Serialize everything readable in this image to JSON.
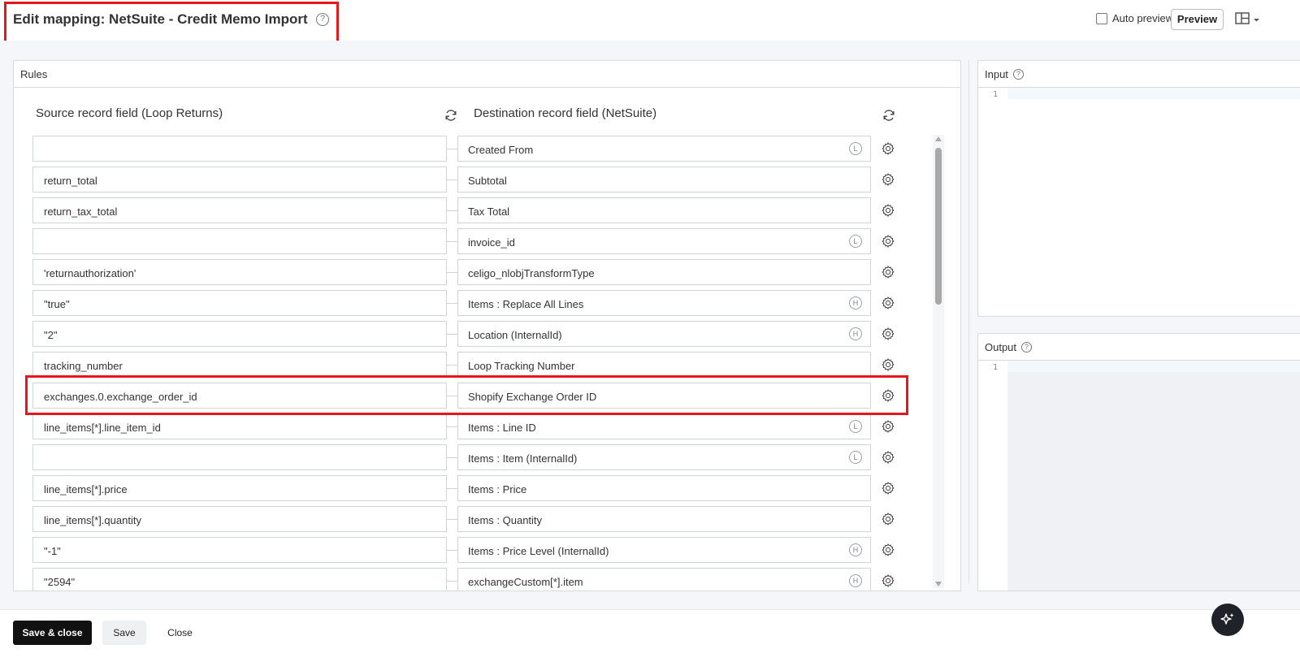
{
  "header": {
    "title": "Edit mapping: NetSuite - Credit Memo Import",
    "help_glyph": "?",
    "auto_preview_label": "Auto preview",
    "preview_button": "Preview"
  },
  "rules": {
    "panel_title": "Rules",
    "source_header": "Source record field (Loop Returns)",
    "destination_header": "Destination record field (NetSuite)",
    "rows": [
      {
        "source": "",
        "destination": "Created From",
        "badge": "L"
      },
      {
        "source": "return_total",
        "destination": "Subtotal",
        "badge": ""
      },
      {
        "source": "return_tax_total",
        "destination": "Tax Total",
        "badge": ""
      },
      {
        "source": "",
        "destination": "invoice_id",
        "badge": "L"
      },
      {
        "source": "'returnauthorization'",
        "destination": "celigo_nlobjTransformType",
        "badge": ""
      },
      {
        "source": "\"true\"",
        "destination": "Items : Replace All Lines",
        "badge": "H"
      },
      {
        "source": "\"2\"",
        "destination": "Location (InternalId)",
        "badge": "H"
      },
      {
        "source": "tracking_number",
        "destination": "Loop Tracking Number",
        "badge": ""
      },
      {
        "source": "exchanges.0.exchange_order_id",
        "destination": "Shopify Exchange Order ID",
        "badge": ""
      },
      {
        "source": "line_items[*].line_item_id",
        "destination": "Items : Line ID",
        "badge": "L"
      },
      {
        "source": "",
        "destination": "Items : Item (InternalId)",
        "badge": "L"
      },
      {
        "source": "line_items[*].price",
        "destination": "Items : Price",
        "badge": ""
      },
      {
        "source": "line_items[*].quantity",
        "destination": "Items : Quantity",
        "badge": ""
      },
      {
        "source": "\"-1\"",
        "destination": "Items : Price Level (InternalId)",
        "badge": "H"
      },
      {
        "source": "\"2594\"",
        "destination": "exchangeCustom[*].item",
        "badge": "H"
      }
    ]
  },
  "input_panel": {
    "title": "Input",
    "line_number": "1"
  },
  "output_panel": {
    "title": "Output",
    "line_number": "1"
  },
  "footer": {
    "save_close": "Save & close",
    "save": "Save",
    "close": "Close"
  },
  "colors": {
    "highlight": "#e8151b",
    "primary_button": "#111111",
    "ai_button": "#1f2329"
  }
}
